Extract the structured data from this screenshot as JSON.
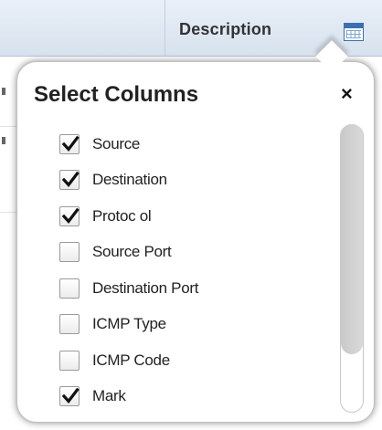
{
  "table": {
    "header_label": "Description"
  },
  "popover": {
    "title": "Select Columns",
    "close_label": "×",
    "options": [
      {
        "label": "Source",
        "checked": true
      },
      {
        "label": "Destination",
        "checked": true
      },
      {
        "label": "Protoc ol",
        "checked": true
      },
      {
        "label": "Source Port",
        "checked": false
      },
      {
        "label": "Destination Port",
        "checked": false
      },
      {
        "label": "ICMP Type",
        "checked": false
      },
      {
        "label": "ICMP Code",
        "checked": false
      },
      {
        "label": "Mark",
        "checked": true
      }
    ]
  },
  "colors": {
    "header_bg": "#dfe8f2",
    "icon_blue": "#3c6fb2",
    "scroll_thumb": "#d0d0d0"
  },
  "icons": {
    "column_chooser": "table-grid-icon",
    "check": "check-icon",
    "close": "close-icon"
  }
}
